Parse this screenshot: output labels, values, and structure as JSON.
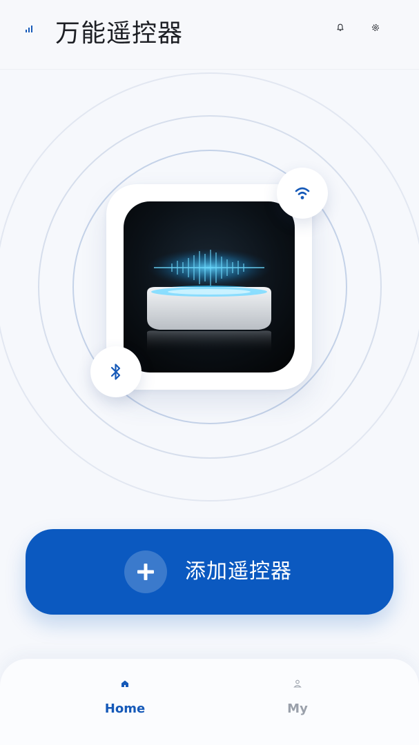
{
  "header": {
    "title": "万能遥控器",
    "icons": {
      "left": "signal-bars-icon",
      "bell": "bell-icon",
      "settings": "gear-icon"
    }
  },
  "device": {
    "image": "smart-ir-hub-image",
    "badges": [
      "wifi-icon",
      "bluetooth-icon"
    ]
  },
  "add_button": {
    "label": "添加遥控器",
    "icon": "plus-icon"
  },
  "nav": {
    "items": [
      {
        "label": "Home",
        "icon": "home-icon",
        "active": true
      },
      {
        "label": "My",
        "icon": "user-icon",
        "active": false
      }
    ]
  },
  "colors": {
    "accent": "#0b59c0",
    "background": "#f6f8fc",
    "inactive": "#9aa0aa"
  }
}
